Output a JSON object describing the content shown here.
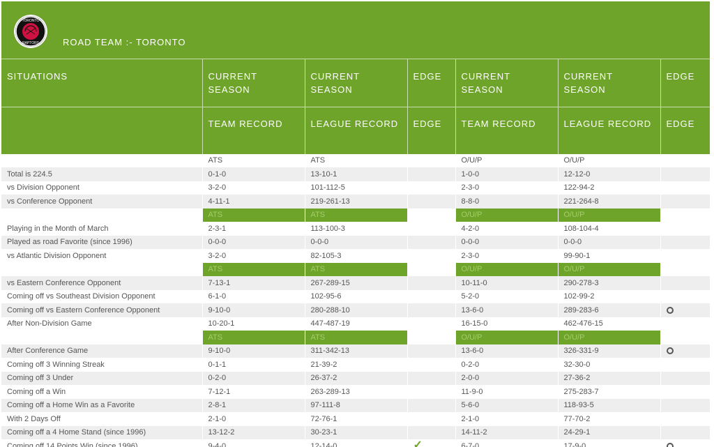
{
  "header": {
    "title": "ROAD TEAM :- TORONTO",
    "logo_text": [
      "TORONTO",
      "RAPTORS"
    ]
  },
  "columns_row1": [
    "SITUATIONS",
    "CURRENT SEASON",
    "CURRENT SEASON",
    "EDGE",
    "CURRENT SEASON",
    "CURRENT SEASON",
    "EDGE"
  ],
  "columns_row2": [
    "",
    "TEAM RECORD",
    "LEAGUE RECORD",
    "EDGE",
    "TEAM RECORD",
    "LEAGUE RECORD",
    "EDGE"
  ],
  "labels_row": [
    "",
    "ATS",
    "ATS",
    "",
    "O/U/P",
    "O/U/P",
    ""
  ],
  "rows": [
    {
      "type": "data",
      "cells": [
        "Total is 224.5",
        "0-1-0",
        "13-10-1",
        "",
        "1-0-0",
        "12-12-0",
        ""
      ]
    },
    {
      "type": "data",
      "cells": [
        "vs Division Opponent",
        "3-2-0",
        "101-112-5",
        "",
        "2-3-0",
        "122-94-2",
        ""
      ]
    },
    {
      "type": "data",
      "cells": [
        "vs Conference Opponent",
        "4-11-1",
        "219-261-13",
        "",
        "8-8-0",
        "221-264-8",
        ""
      ]
    },
    {
      "type": "sep",
      "cells": [
        "",
        "ATS",
        "ATS",
        "",
        "O/U/P",
        "O/U/P",
        ""
      ]
    },
    {
      "type": "data",
      "cells": [
        "Playing in the Month of March",
        "2-3-1",
        "113-100-3",
        "",
        "4-2-0",
        "108-104-4",
        ""
      ]
    },
    {
      "type": "data",
      "cells": [
        "Played as road Favorite (since 1996)",
        "0-0-0",
        "0-0-0",
        "",
        "0-0-0",
        "0-0-0",
        ""
      ]
    },
    {
      "type": "data",
      "cells": [
        "vs Atlantic Division Opponent",
        "3-2-0",
        "82-105-3",
        "",
        "2-3-0",
        "99-90-1",
        ""
      ]
    },
    {
      "type": "sep",
      "cells": [
        "",
        "ATS",
        "ATS",
        "",
        "O/U/P",
        "O/U/P",
        ""
      ]
    },
    {
      "type": "data",
      "cells": [
        "vs Eastern Conference Opponent",
        "7-13-1",
        "267-289-15",
        "",
        "10-11-0",
        "290-278-3",
        ""
      ]
    },
    {
      "type": "data",
      "cells": [
        "Coming off vs Southeast Division Opponent",
        "6-1-0",
        "102-95-6",
        "",
        "5-2-0",
        "102-99-2",
        ""
      ]
    },
    {
      "type": "data",
      "cells": [
        "Coming off vs Eastern Conference Opponent",
        "9-10-0",
        "280-288-10",
        "",
        "13-6-0",
        "289-283-6",
        ""
      ],
      "edge2": "o"
    },
    {
      "type": "data",
      "cells": [
        "After Non-Division Game",
        "10-20-1",
        "447-487-19",
        "",
        "16-15-0",
        "462-476-15",
        ""
      ]
    },
    {
      "type": "sep",
      "cells": [
        "",
        "ATS",
        "ATS",
        "",
        "O/U/P",
        "O/U/P",
        ""
      ]
    },
    {
      "type": "data",
      "cells": [
        "After Conference Game",
        "9-10-0",
        "311-342-13",
        "",
        "13-6-0",
        "326-331-9",
        ""
      ],
      "edge2": "o"
    },
    {
      "type": "data",
      "cells": [
        "Coming off 3 Winning Streak",
        "0-1-1",
        "21-39-2",
        "",
        "0-2-0",
        "32-30-0",
        ""
      ]
    },
    {
      "type": "data",
      "cells": [
        "Coming off 3 Under",
        "0-2-0",
        "26-37-2",
        "",
        "2-0-0",
        "27-36-2",
        ""
      ]
    },
    {
      "type": "data",
      "cells": [
        "Coming off a Win",
        "7-12-1",
        "263-289-13",
        "",
        "11-9-0",
        "275-283-7",
        ""
      ]
    },
    {
      "type": "data",
      "cells": [
        "Coming off a Home Win as a Favorite",
        "2-8-1",
        "97-111-8",
        "",
        "5-6-0",
        "118-93-5",
        ""
      ]
    },
    {
      "type": "data",
      "cells": [
        "With 2 Days Off",
        "2-1-0",
        "72-76-1",
        "",
        "2-1-0",
        "77-70-2",
        ""
      ]
    },
    {
      "type": "data",
      "cells": [
        "Coming off a 4 Home Stand (since 1996)",
        "13-12-2",
        "30-23-1",
        "",
        "14-11-2",
        "24-29-1",
        ""
      ]
    },
    {
      "type": "data",
      "cells": [
        "Coming off 14 Points Win (since 1996)",
        "9-4-0",
        "12-14-0",
        "",
        "6-7-0",
        "17-9-0",
        ""
      ],
      "edge1": "check",
      "edge2": "o"
    }
  ],
  "colors": {
    "accent": "#6ea42a",
    "row_alt": "#eeeeee"
  }
}
